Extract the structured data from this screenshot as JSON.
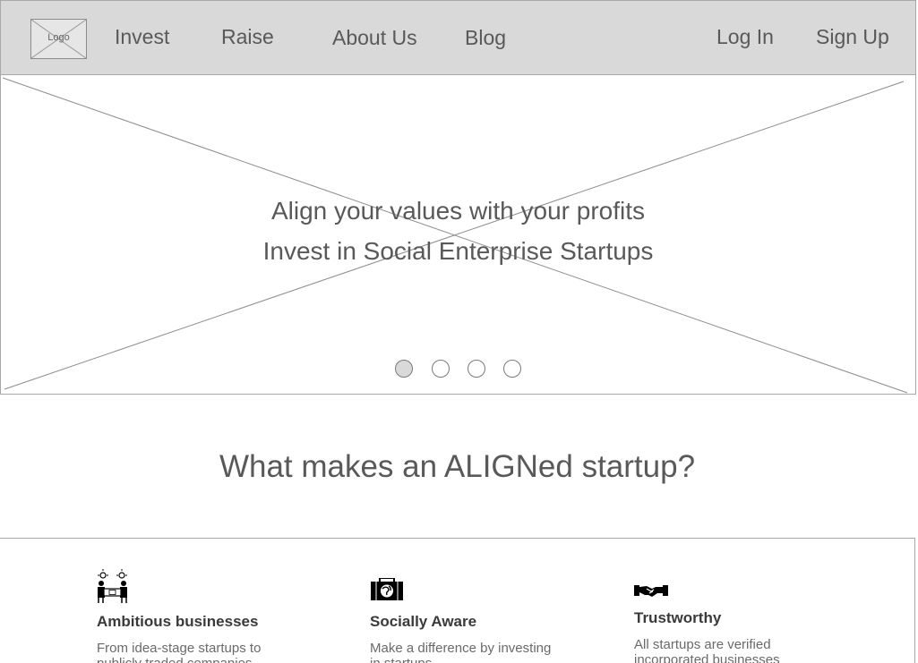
{
  "header": {
    "logo_label": "Logo",
    "nav": {
      "invest": "Invest",
      "raise": "Raise",
      "about": "About Us",
      "blog": "Blog",
      "login": "Log In",
      "signup": "Sign Up"
    }
  },
  "hero": {
    "line1": "Align your values with your profits",
    "line2": "Invest in Social Enterprise Startups",
    "carousel_slides": 4,
    "active_slide": 1
  },
  "section": {
    "title": "What makes an ALIGNed startup?"
  },
  "features": [
    {
      "icon": "meeting-table-icon",
      "title": "Ambitious businesses",
      "description": "From idea-stage startups to publicly traded companies"
    },
    {
      "icon": "briefcase-globe-icon",
      "title": "Socially Aware",
      "description": "Make a difference by investing in startups"
    },
    {
      "icon": "handshake-icon",
      "title": "Trustworthy",
      "description": "All startups are verified incorporated businesses"
    }
  ],
  "colors": {
    "nav_background": "#d9d9d9",
    "text": "#595959",
    "border": "#a8a8a8"
  }
}
